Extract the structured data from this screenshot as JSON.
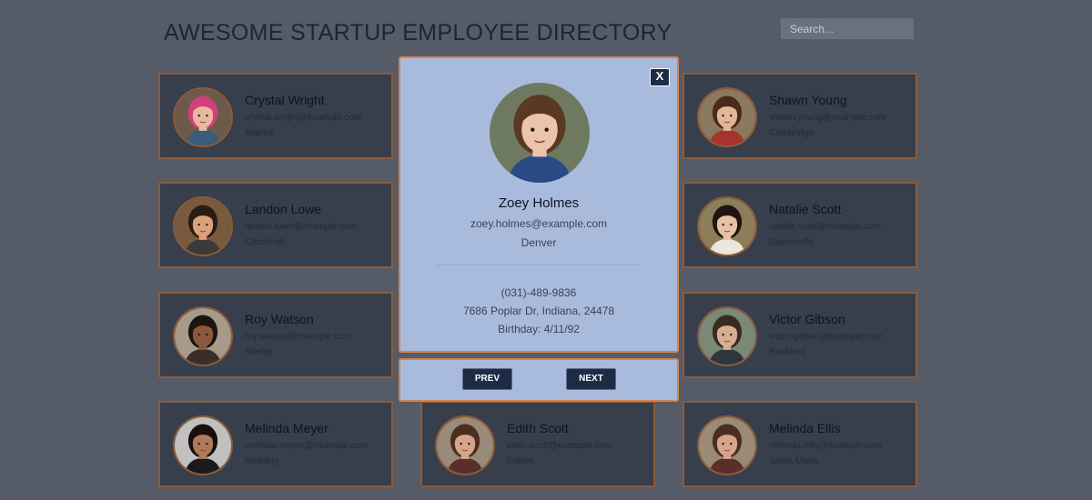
{
  "header": {
    "title": "AWESOME STARTUP EMPLOYEE DIRECTORY"
  },
  "search": {
    "placeholder": "Search..."
  },
  "employees": [
    {
      "name": "Crystal Wright",
      "email": "crystal.wright@example.com",
      "city": "Atlanta",
      "hair": "#d0407a",
      "skin": "#e8b8a0",
      "shirt": "#3a5d7a",
      "bg": "#6e5a4a"
    },
    {
      "name": "Shawn Young",
      "email": "shawn.young@example.com",
      "city": "Cambridge",
      "hair": "#4a2a1a",
      "skin": "#e2b69a",
      "shirt": "#a8322c",
      "bg": "#8a7a60"
    },
    {
      "name": "Landon Lowe",
      "email": "landon.lowe@example.com",
      "city": "Cincinnati",
      "hair": "#2a1c14",
      "skin": "#d9a17e",
      "shirt": "#3a3a3a",
      "bg": "#7a5a3e"
    },
    {
      "name": "Natalie Scott",
      "email": "natalie.scott@example.com",
      "city": "Gainesville",
      "hair": "#1e1410",
      "skin": "#e6c2a4",
      "shirt": "#ece6dc",
      "bg": "#8c7e5a"
    },
    {
      "name": "Roy Watson",
      "email": "roy.watson@example.com",
      "city": "Shelby",
      "hair": "#1c1410",
      "skin": "#8a5a3e",
      "shirt": "#3a2e28",
      "bg": "#a89a8a"
    },
    {
      "name": "Victor Gibson",
      "email": "victor.gibson@example.com",
      "city": "Rockford",
      "hair": "#3a2a20",
      "skin": "#d8ad92",
      "shirt": "#2e3640",
      "bg": "#7a8878"
    },
    {
      "name": "Melinda Meyer",
      "email": "melinda.meyer@example.com",
      "city": "Redding",
      "hair": "#16100c",
      "skin": "#b07a5a",
      "shirt": "#1a1a1a",
      "bg": "#c0c0c0"
    },
    {
      "name": "Edith Scott",
      "email": "edith.scott@example.com",
      "city": "Gilbert",
      "hair": "#4a2e20",
      "skin": "#d7a38a",
      "shirt": "#5a2e2a",
      "bg": "#9a8a78"
    },
    {
      "name": "Melinda Ellis",
      "email": "melinda.ellis@example.com",
      "city": "Santa Maria",
      "hair": "#4a2e20",
      "skin": "#d7a38a",
      "shirt": "#5a2e2a",
      "bg": "#9a8a78"
    }
  ],
  "modal": {
    "close_label": "X",
    "name": "Zoey Holmes",
    "email": "zoey.holmes@example.com",
    "city": "Denver",
    "phone": "(031)-489-9836",
    "address": "7686 Poplar Dr, Indiana, 24478",
    "birthday": "Birthday: 4/11/92",
    "hair": "#5a3824",
    "skin": "#ecc4ac",
    "shirt": "#2a4a86",
    "bg": "#6e7a60"
  },
  "nav": {
    "prev_label": "PREV",
    "next_label": "NEXT"
  },
  "colors": {
    "accent_border": "#d8834a",
    "card_border": "#8c5b3a",
    "button": "#1d2b45",
    "modal_bg": "#a8bbdd"
  }
}
